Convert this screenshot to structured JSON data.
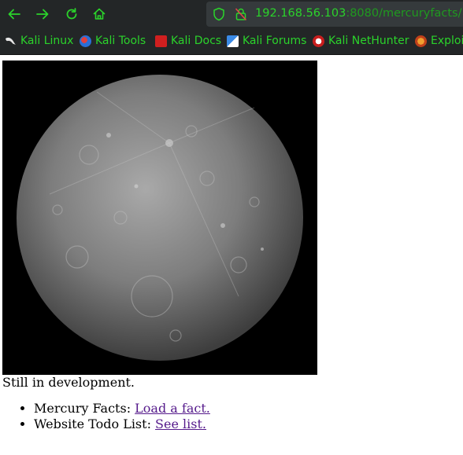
{
  "toolbar": {
    "url_host": "192.168.56.103",
    "url_rest": ":8080/mercuryfacts/"
  },
  "bookmarks": [
    {
      "label": "Kali Linux",
      "icon": "kali-dragon-icon"
    },
    {
      "label": "Kali Tools",
      "icon": "kali-tools-icon"
    },
    {
      "label": "Kali Docs",
      "icon": "kali-docs-icon"
    },
    {
      "label": "Kali Forums",
      "icon": "kali-forums-icon"
    },
    {
      "label": "Kali NetHunter",
      "icon": "nethunter-icon"
    },
    {
      "label": "Exploit",
      "icon": "exploit-db-icon"
    }
  ],
  "page": {
    "status": "Still in development.",
    "items": [
      {
        "prefix": "Mercury Facts: ",
        "link": "Load a fact."
      },
      {
        "prefix": "Website Todo List: ",
        "link": "See list."
      }
    ]
  },
  "colors": {
    "toolbar_bg": "#232627",
    "url_green": "#2bd32b",
    "visited_link": "#551a8b"
  }
}
